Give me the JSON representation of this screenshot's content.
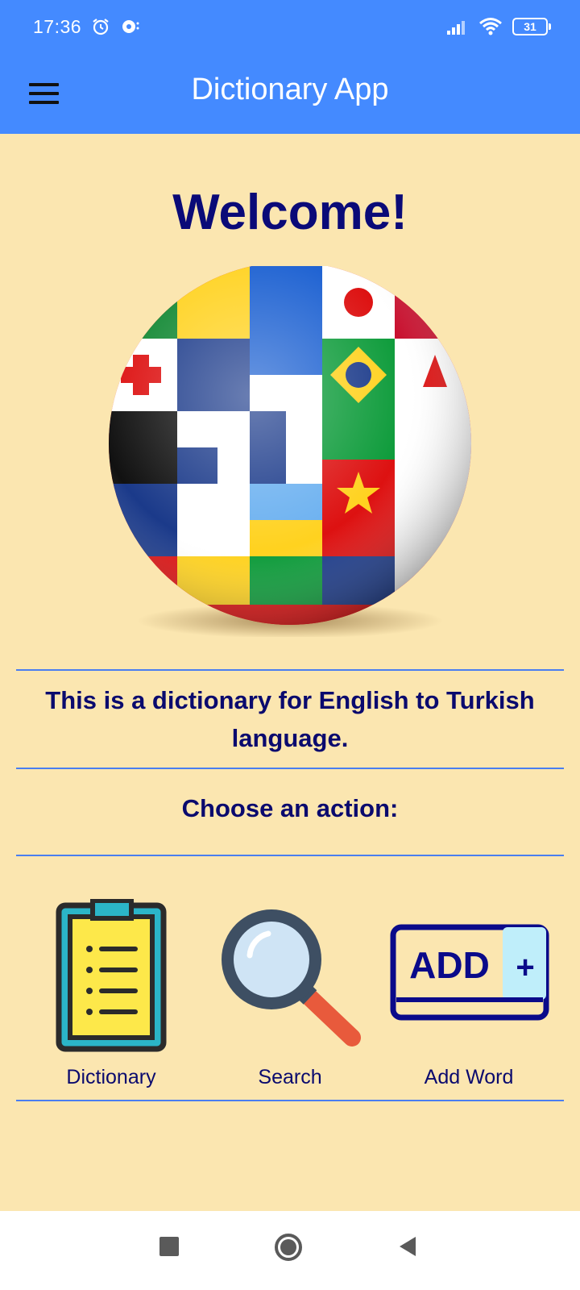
{
  "status_bar": {
    "time": "17:36",
    "battery": "31",
    "icons": [
      "alarm-icon",
      "cast-icon",
      "signal-icon",
      "wifi-icon",
      "battery-icon"
    ]
  },
  "app_bar": {
    "title": "Dictionary App",
    "menu_icon": "hamburger-menu-icon"
  },
  "main": {
    "welcome": "Welcome!",
    "description": "This is a dictionary for English to Turkish language.",
    "choose_prompt": "Choose an action:",
    "actions": [
      {
        "label": "Dictionary",
        "icon": "clipboard-list-icon"
      },
      {
        "label": "Search",
        "icon": "magnifier-icon"
      },
      {
        "label": "Add Word",
        "icon": "add-plus-icon",
        "icon_text": "ADD",
        "icon_symbol": "+"
      }
    ]
  },
  "nav_bar": {
    "buttons": [
      "recents-square-icon",
      "home-circle-icon",
      "back-triangle-icon"
    ]
  },
  "colors": {
    "app_bar": "#448aff",
    "background": "#fbe6b0",
    "text_primary": "#0a0a78",
    "divider": "#4a7ef0"
  }
}
